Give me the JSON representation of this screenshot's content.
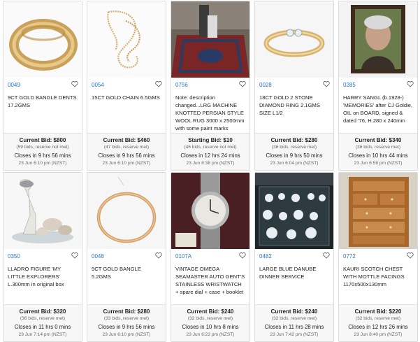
{
  "colors": {
    "lot_link": "#2a72c7",
    "card_border": "#dcdcdc",
    "bid_bg": "#f7f7f7"
  },
  "icons": {
    "favourite": "heart-outline-icon"
  },
  "lots": [
    {
      "lot": "0049",
      "title": "9CT GOLD BANGLE DENTS 17.2GMS",
      "bid_label": "Current Bid: $800",
      "bid_meta": "(59 bids, reserve not met)",
      "closes": "Closes in 9 hrs 56 mins",
      "close_date": "23 Jun 6:10 pm (NZST)",
      "image": "gold-bangle-engraved"
    },
    {
      "lot": "0054",
      "title": "15CT GOLD CHAIN 6.5GMS",
      "bid_label": "Current Bid: $460",
      "bid_meta": "(47 bids, reserve met)",
      "closes": "Closes in 9 hrs 56 mins",
      "close_date": "23 Jun 6:10 pm (NZST)",
      "image": "gold-chain"
    },
    {
      "lot": "0756",
      "title": "Note: description changed...LRG MACHINE KNOTTED PERSIAN STYLE WOOL RUG 3000 x 2500mm with some paint marks",
      "bid_label": "Starting Bid: $10",
      "bid_meta": "(46 bids, reserve not met)",
      "closes": "Closes in 12 hrs 24 mins",
      "close_date": "23 Jun 8:38 pm (NZST)",
      "image": "persian-rug"
    },
    {
      "lot": "0028",
      "title": "18CT GOLD 2 STONE DIAMOND RING 2.1GMS SIZE L1/2",
      "bid_label": "Current Bid: $280",
      "bid_meta": "(36 bids, reserve met)",
      "closes": "Closes in 9 hrs 50 mins",
      "close_date": "23 Jun 6:04 pm (NZST)",
      "image": "diamond-ring"
    },
    {
      "lot": "0285",
      "title": "HARRY SANGL (b.1928-) 'MEMORIES' after CJ Goldie, OIL on BOARD, signed & dated '76, H.280 x 240mm",
      "bid_label": "Current Bid: $340",
      "bid_meta": "(36 bids, reserve met)",
      "closes": "Closes in 10 hrs 44 mins",
      "close_date": "23 Jun 6:58 pm (NZST)",
      "image": "portrait-painting"
    },
    {
      "lot": "0350",
      "title": "LLADRO FIGURE 'MY LITTLE EXPLORERS' L.300mm in original box",
      "bid_label": "Current Bid: $320",
      "bid_meta": "(36 bids, reserve met)",
      "closes": "Closes in 11 hrs 0 mins",
      "close_date": "23 Jun 7:14 pm (NZST)",
      "image": "lladro-figure"
    },
    {
      "lot": "0048",
      "title": "9CT GOLD BANGLE 5.2GMS",
      "bid_label": "Current Bid: $280",
      "bid_meta": "(33 bids, reserve met)",
      "closes": "Closes in 9 hrs 56 mins",
      "close_date": "23 Jun 6:10 pm (NZST)",
      "image": "gold-bangle-plain"
    },
    {
      "lot": "0107A",
      "title": "VINTAGE OMEGA SEAMASTER AUTO GENT'S STAINLESS WRISTWATCH + spare dial + case + booklet",
      "bid_label": "Current Bid: $240",
      "bid_meta": "(32 bids, reserve met)",
      "closes": "Closes in 10 hrs 8 mins",
      "close_date": "23 Jun 6:22 pm (NZST)",
      "image": "omega-watch"
    },
    {
      "lot": "0482",
      "title": "LARGE BLUE DANUBE DINNER SERVICE",
      "bid_label": "Current Bid: $240",
      "bid_meta": "(32 bids, reserve met)",
      "closes": "Closes in 11 hrs 28 mins",
      "close_date": "23 Jun 7:42 pm (NZST)",
      "image": "dinner-service"
    },
    {
      "lot": "0772",
      "title": "KAURI SCOTCH CHEST WITH MOTTLE FACINGS 1170x500x130mm",
      "bid_label": "Current Bid: $220",
      "bid_meta": "(32 bids, reserve met)",
      "closes": "Closes in 12 hrs 26 mins",
      "close_date": "23 Jun 8:40 pm (NZST)",
      "image": "kauri-chest"
    }
  ]
}
